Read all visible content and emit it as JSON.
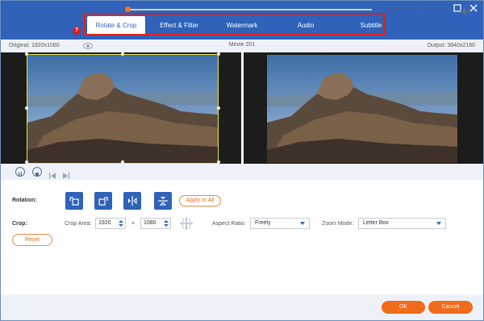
{
  "tabs": [
    {
      "label": "Rotate & Crop",
      "active": true
    },
    {
      "label": "Effect & Filter",
      "active": false
    },
    {
      "label": "Watermark",
      "active": false
    },
    {
      "label": "Audio",
      "active": false
    },
    {
      "label": "Subtitle",
      "active": false
    }
  ],
  "badge": "?",
  "window": {
    "maximize_icon": "maximize-icon",
    "close_icon": "close-icon"
  },
  "info": {
    "original": "Original: 1920x1080",
    "movie": "Movie 201",
    "output": "Output: 3840x2160"
  },
  "playback": {
    "time": "00:00:08.18/00:01:03.10",
    "progress": 0.14
  },
  "rotation": {
    "label": "Rotation:",
    "buttons": [
      "rotate-left-icon",
      "rotate-right-icon",
      "flip-horizontal-icon",
      "flip-vertical-icon"
    ],
    "apply_all": "Apply to All"
  },
  "crop": {
    "label": "Crop:",
    "area_label": "Crop Area:",
    "width": "1920",
    "times": "×",
    "height": "1080",
    "aspect_label": "Aspect Ratio:",
    "aspect_value": "Freely",
    "zoom_label": "Zoom Mode:",
    "zoom_value": "Letter Box",
    "reset": "Reset"
  },
  "footer": {
    "ok": "OK",
    "cancel": "Cancel"
  },
  "colors": {
    "accent": "#2f62b8",
    "orange": "#f06b1b",
    "highlight": "#e01f1f"
  }
}
